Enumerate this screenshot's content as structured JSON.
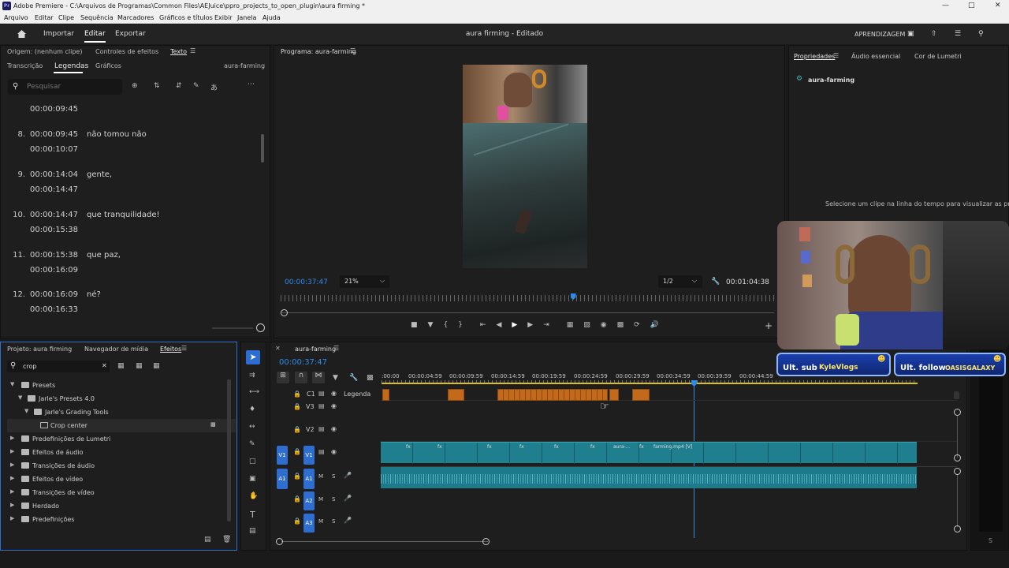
{
  "window": {
    "title": "Adobe Premiere - C:\\Arquivos de Programas\\Common Files\\AEJuice\\ppro_projects_to_open_plugin\\aura firming *",
    "app_icon": "Pr"
  },
  "menu": [
    "Arquivo",
    "Editar",
    "Clipe",
    "Sequência",
    "Marcadores",
    "Gráficos e títulos",
    "Exibir",
    "Janela",
    "Ajuda"
  ],
  "header": {
    "workspaces": [
      "Importar",
      "Editar",
      "Exportar"
    ],
    "active": "Editar",
    "center": "aura firming - Editado",
    "right": "APRENDIZAGEM"
  },
  "source_panel": {
    "tabs1": [
      "Origem: (nenhum clipe)",
      "Controles de efeitos",
      "Texto"
    ],
    "tabs2": [
      "Transcrição",
      "Legendas",
      "Gráficos"
    ],
    "active2": "Legendas",
    "seq": "aura-farming",
    "search_placeholder": "Pesquisar",
    "captions": [
      {
        "idx": "",
        "start": "",
        "end": "00:00:09:45",
        "text": ""
      },
      {
        "idx": "8.",
        "start": "00:00:09:45",
        "end": "00:00:10:07",
        "text": "não tomou não"
      },
      {
        "idx": "9.",
        "start": "00:00:14:04",
        "end": "00:00:14:47",
        "text": "gente,"
      },
      {
        "idx": "10.",
        "start": "00:00:14:47",
        "end": "00:00:15:38",
        "text": "que tranquilidade!"
      },
      {
        "idx": "11.",
        "start": "00:00:15:38",
        "end": "00:00:16:09",
        "text": "que paz,"
      },
      {
        "idx": "12.",
        "start": "00:00:16:09",
        "end": "00:00:16:33",
        "text": "né?"
      }
    ]
  },
  "program": {
    "title": "Programa: aura-farming",
    "timecode": "00:00:37:47",
    "zoom": "21%",
    "quality": "1/2",
    "duration": "00:01:04:38",
    "playhead_fraction": 0.59
  },
  "properties": {
    "tabs": [
      "Propriedades",
      "Áudio essencial",
      "Cor de Lumetri"
    ],
    "item": "aura-farming",
    "hint": "Selecione um clipe na linha do tempo para visualizar as propriedades."
  },
  "project": {
    "tabs": [
      "Projeto: aura firming",
      "Navegador de mídia",
      "Efeitos"
    ],
    "search": "crop",
    "tree": [
      {
        "label": "Presets",
        "depth": 0,
        "open": true
      },
      {
        "label": "Jarle's Presets 4.0",
        "depth": 1,
        "open": true
      },
      {
        "label": "Jarle's Grading Tools",
        "depth": 2,
        "open": true
      },
      {
        "label": "Crop center",
        "depth": 3,
        "open": false
      },
      {
        "label": "Predefinições de Lumetri",
        "depth": 0,
        "open": false
      },
      {
        "label": "Efeitos de áudio",
        "depth": 0,
        "open": false
      },
      {
        "label": "Transições de áudio",
        "depth": 0,
        "open": false
      },
      {
        "label": "Efeitos de vídeo",
        "depth": 0,
        "open": false
      },
      {
        "label": "Transições de vídeo",
        "depth": 0,
        "open": false
      },
      {
        "label": "Herdado",
        "depth": 0,
        "open": false
      },
      {
        "label": "Predefinições",
        "depth": 0,
        "open": false
      }
    ]
  },
  "timeline": {
    "title": "aura-farming",
    "timecode": "00:00:37:47",
    "ruler": [
      ":00:00",
      "00:00:04:59",
      "00:00:09:59",
      "00:00:14:59",
      "00:00:19:59",
      "00:00:24:59",
      "00:00:29:59",
      "00:00:34:59",
      "00:00:39:59",
      "00:00:44:59"
    ],
    "tracks": {
      "c1": "C1",
      "caption": "Legenda",
      "v3": "V3",
      "v2": "V2",
      "v1": "V1",
      "a1": "A1",
      "a2": "A2",
      "a3": "A3",
      "m": "M",
      "s": "S"
    },
    "clip_labels": [
      "aura-...",
      "farming.mp4 [V]"
    ],
    "fx": "fx"
  },
  "overlay": {
    "sub_label": "Ult. sub",
    "sub_name": "KyleVlogs",
    "follow_label": "Ult. follow",
    "follow_name": "OASISGALAXY"
  },
  "colors": {
    "accent": "#2d8ceb",
    "clip": "#1f7f8f",
    "caption": "#c26a1a",
    "banner": "#1b3fae"
  }
}
